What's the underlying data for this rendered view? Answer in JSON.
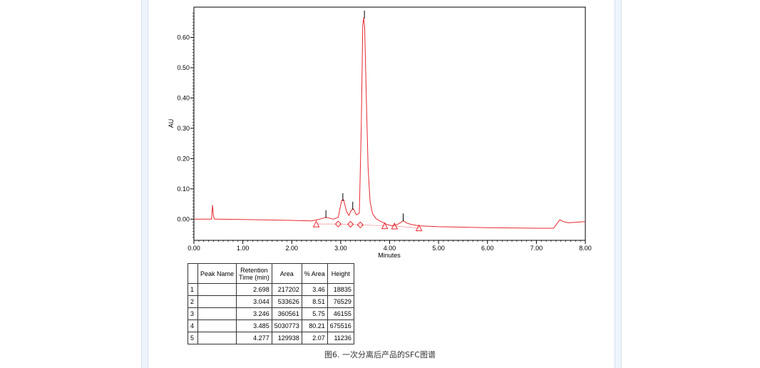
{
  "chart_data": {
    "type": "line",
    "xlabel": "Minutes",
    "ylabel": "AU",
    "xlim": [
      0,
      8
    ],
    "ylim": [
      -0.07,
      0.7
    ],
    "x_ticks": [
      0,
      1,
      2,
      3,
      4,
      5,
      6,
      7,
      8
    ],
    "x_tick_labels": [
      "0.00",
      "1.00",
      "2.00",
      "3.00",
      "4.00",
      "5.00",
      "6.00",
      "7.00",
      "8.00"
    ],
    "y_ticks": [
      0,
      0.1,
      0.2,
      0.3,
      0.4,
      0.5,
      0.6
    ],
    "y_tick_labels": [
      "0.00",
      "0.10",
      "0.20",
      "0.30",
      "0.40",
      "0.50",
      "0.60"
    ],
    "grid": false,
    "line_color": "#e8282f",
    "marker_color": "#e8282f",
    "series": [
      {
        "x": [
          0.0,
          0.36,
          0.38,
          0.4,
          0.42,
          0.44,
          1.0,
          2.0,
          2.4,
          2.55,
          2.7,
          2.85,
          2.95,
          3.02,
          3.06,
          3.12,
          3.17,
          3.21,
          3.26,
          3.32,
          3.38,
          3.42,
          3.45,
          3.47,
          3.49,
          3.52,
          3.56,
          3.6,
          3.65,
          3.72,
          3.8,
          3.88,
          3.95,
          4.05,
          4.15,
          4.22,
          4.28,
          4.35,
          4.45,
          4.6,
          5.0,
          6.0,
          7.0,
          7.35,
          7.42,
          7.48,
          7.55,
          7.65,
          8.0
        ],
        "y": [
          0.0,
          0.0,
          0.046,
          0.01,
          0.0,
          0.0,
          -0.001,
          -0.004,
          -0.006,
          -0.001,
          0.006,
          0.0,
          0.006,
          0.062,
          0.064,
          0.025,
          0.012,
          0.028,
          0.034,
          0.014,
          0.02,
          0.3,
          0.64,
          0.665,
          0.63,
          0.42,
          0.17,
          0.06,
          0.018,
          0.002,
          -0.006,
          -0.012,
          -0.018,
          -0.022,
          -0.018,
          -0.012,
          -0.005,
          -0.013,
          -0.018,
          -0.022,
          -0.025,
          -0.028,
          -0.03,
          -0.03,
          -0.015,
          -0.002,
          -0.008,
          -0.012,
          -0.008
        ]
      }
    ],
    "peak_marks": [
      {
        "x": 2.698,
        "y": 0.006
      },
      {
        "x": 3.044,
        "y": 0.062
      },
      {
        "x": 3.246,
        "y": 0.034
      },
      {
        "x": 3.485,
        "y": 0.665
      },
      {
        "x": 4.277,
        "y": -0.005
      }
    ],
    "triangle_markers": [
      {
        "x": 2.5,
        "y": -0.016
      },
      {
        "x": 3.9,
        "y": -0.022
      },
      {
        "x": 4.1,
        "y": -0.023
      },
      {
        "x": 4.6,
        "y": -0.029
      }
    ],
    "diamond_markers": [
      {
        "x": 2.95,
        "y": -0.016
      },
      {
        "x": 3.2,
        "y": -0.017
      },
      {
        "x": 3.4,
        "y": -0.019
      }
    ]
  },
  "table": {
    "headers": {
      "peak_name": "Peak Name",
      "rt_line1": "Retention",
      "rt_line2": "Time (min)",
      "area": "Area",
      "pct_area": "% Area",
      "height": "Height"
    },
    "rows": [
      {
        "idx": "1",
        "name": "",
        "rt": "2.698",
        "area": "217202",
        "pct": "3.46",
        "height": "18835"
      },
      {
        "idx": "2",
        "name": "",
        "rt": "3.044",
        "area": "533626",
        "pct": "8.51",
        "height": "76529"
      },
      {
        "idx": "3",
        "name": "",
        "rt": "3.246",
        "area": "360561",
        "pct": "5.75",
        "height": "46155"
      },
      {
        "idx": "4",
        "name": "",
        "rt": "3.485",
        "area": "5030773",
        "pct": "80.21",
        "height": "675516"
      },
      {
        "idx": "5",
        "name": "",
        "rt": "4.277",
        "area": "129938",
        "pct": "2.07",
        "height": "11236"
      }
    ]
  },
  "caption": "图6. 一次分离后产品的SFC图谱"
}
